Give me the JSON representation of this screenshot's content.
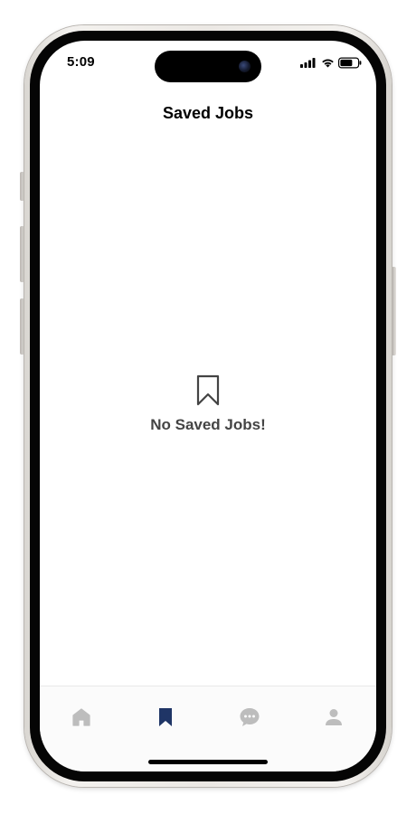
{
  "status_bar": {
    "time": "5:09",
    "icons": [
      "cellular-signal-icon",
      "wifi-icon",
      "battery-icon"
    ]
  },
  "header": {
    "title": "Saved Jobs"
  },
  "empty_state": {
    "icon": "bookmark-outline-icon",
    "message": "No Saved Jobs!"
  },
  "tab_bar": {
    "active_color": "#1f3566",
    "inactive_color": "#bdbdbd",
    "tabs": [
      {
        "icon": "home-icon",
        "active": false
      },
      {
        "icon": "bookmark-icon",
        "active": true
      },
      {
        "icon": "chat-bubble-icon",
        "active": false
      },
      {
        "icon": "person-icon",
        "active": false
      }
    ]
  }
}
